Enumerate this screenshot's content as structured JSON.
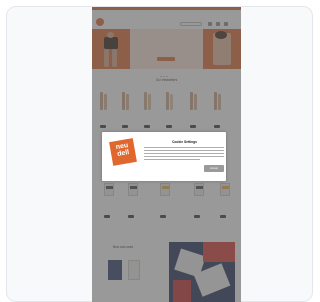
{
  "modal": {
    "logo_line1": "neu",
    "logo_line2": "dell",
    "title": "Cookie Settings",
    "accept_label": "Accept"
  },
  "page": {
    "section1_title": "Our bestsellers",
    "section3_title": "New and used"
  },
  "colors": {
    "brand_orange": "#e0682e",
    "overlay": "rgba(90,90,90,0.62)",
    "navy": "#1e2b57"
  }
}
